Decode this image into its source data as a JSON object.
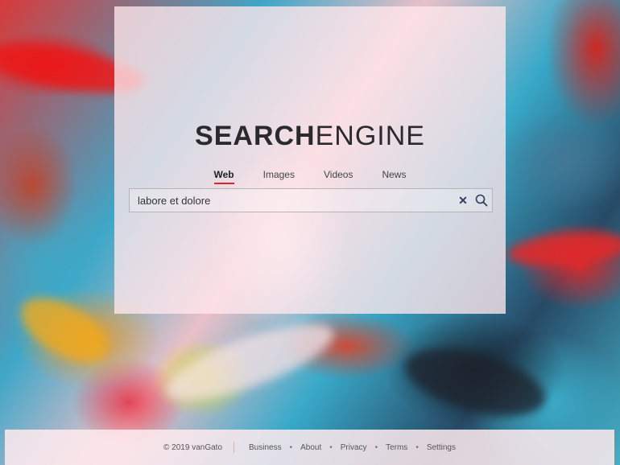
{
  "logo": {
    "bold": "SEARCH",
    "light": "ENGINE"
  },
  "tabs": [
    {
      "label": "Web",
      "active": true
    },
    {
      "label": "Images",
      "active": false
    },
    {
      "label": "Videos",
      "active": false
    },
    {
      "label": "News",
      "active": false
    }
  ],
  "search": {
    "value": "labore et dolore",
    "clear_icon": "close-icon",
    "search_icon": "search-icon"
  },
  "footer": {
    "copyright": "© 2019 vanGato",
    "links": [
      "Business",
      "About",
      "Privacy",
      "Terms",
      "Settings"
    ],
    "separator": "•"
  },
  "colors": {
    "accent": "#d9232e",
    "text": "#2a2a2e",
    "icon": "#2c3e5e"
  }
}
